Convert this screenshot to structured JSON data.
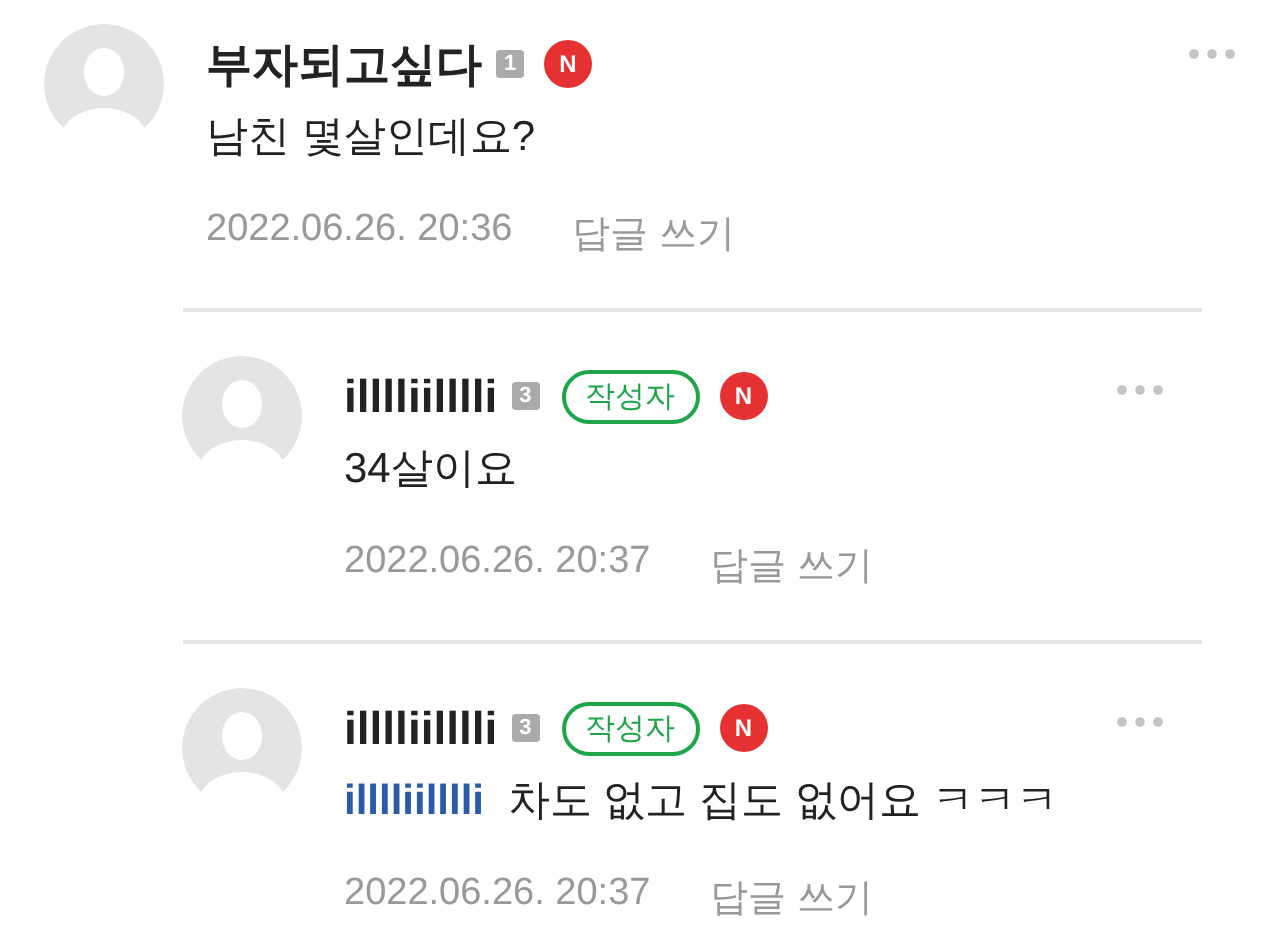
{
  "comments": [
    {
      "reply": false,
      "author": "부자되고싶다",
      "level": "1",
      "new_badge": "N",
      "text": "남친 몇살인데요?",
      "date": "2022.06.26. 20:36",
      "reply_link": "답글 쓰기"
    },
    {
      "reply": true,
      "author": "illlliilllli",
      "level": "3",
      "author_badge": "작성자",
      "new_badge": "N",
      "text": "34살이요",
      "date": "2022.06.26. 20:37",
      "reply_link": "답글 쓰기"
    },
    {
      "reply": true,
      "author": "illlliilllli",
      "level": "3",
      "author_badge": "작성자",
      "new_badge": "N",
      "mention": "illlliilllli",
      "text": "차도 없고 집도 없어요 ㅋㅋㅋ",
      "date": "2022.06.26. 20:37",
      "reply_link": "답글 쓰기"
    }
  ]
}
